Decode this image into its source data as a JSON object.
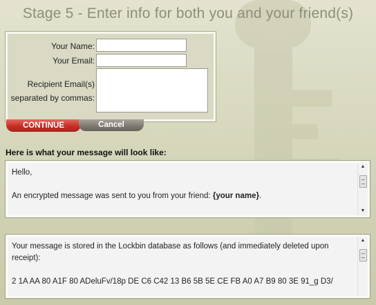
{
  "page": {
    "title": "Stage 5 - Enter info for both you and your friend(s)"
  },
  "form": {
    "name_label": "Your Name:",
    "email_label": "Your Email:",
    "recipient_label_line1": "Recipient Email(s)",
    "recipient_label_line2": "separated by commas:",
    "name_value": "",
    "email_value": "",
    "recipients_value": ""
  },
  "buttons": {
    "continue_label": "CONTINUE",
    "cancel_label": "Cancel"
  },
  "preview": {
    "heading": "Here is what your message will look like:",
    "message": {
      "greeting": "Hello,",
      "line_prefix": "An encrypted message was sent to you from your friend: ",
      "name_placeholder": "{your name}",
      "line_suffix": "."
    },
    "storage": {
      "line1": "Your message is stored in the Lockbin database as follows (and immediately deleted upon",
      "line2": "receipt):",
      "cipher": "2 1A AA 80 A1F 80 ADeluFv/18p DE C6 C42 13 B6 5B 5E CE FB A0 A7 B9 80 3E 91_g D3/"
    }
  },
  "colors": {
    "continue_button": "#c72e26",
    "cancel_button": "#7c786f",
    "title_text": "#8e8f77"
  }
}
